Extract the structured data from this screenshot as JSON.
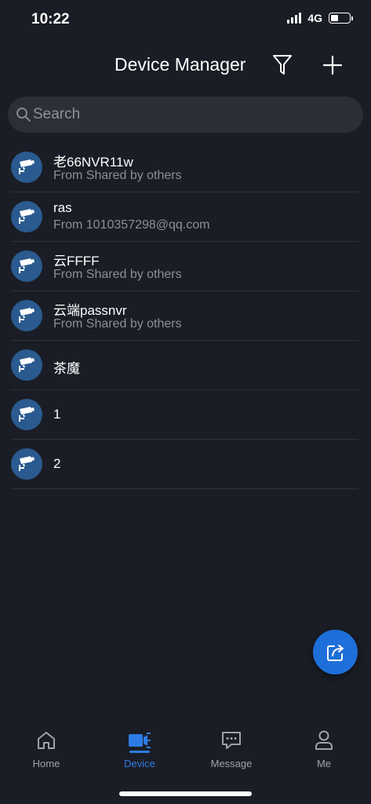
{
  "status_bar": {
    "time": "10:22",
    "network": "4G",
    "battery_level": 0.4
  },
  "header": {
    "title": "Device Manager",
    "filter_icon": "filter-funnel-icon",
    "add_icon": "plus-icon"
  },
  "search": {
    "placeholder": "Search",
    "value": ""
  },
  "devices": [
    {
      "name": "老66NVR11w",
      "subtitle": "From Shared by others"
    },
    {
      "name": "ras",
      "subtitle": "From 1010357298@qq.com"
    },
    {
      "name": "云FFFF",
      "subtitle": "From Shared by others"
    },
    {
      "name": "云端passnvr",
      "subtitle": "From Shared by others"
    },
    {
      "name": "茶魔",
      "subtitle": ""
    },
    {
      "name": "1",
      "subtitle": ""
    },
    {
      "name": "2",
      "subtitle": ""
    }
  ],
  "fab": {
    "icon": "share-icon"
  },
  "tabs": [
    {
      "label": "Home",
      "icon": "home-icon",
      "active": false
    },
    {
      "label": "Device",
      "icon": "video-camera-icon",
      "active": true
    },
    {
      "label": "Message",
      "icon": "chat-bubble-icon",
      "active": false
    },
    {
      "label": "Me",
      "icon": "person-icon",
      "active": false
    }
  ],
  "colors": {
    "background": "#1a1d25",
    "accent": "#2d7ce6",
    "avatar": "#2a5a8f"
  }
}
